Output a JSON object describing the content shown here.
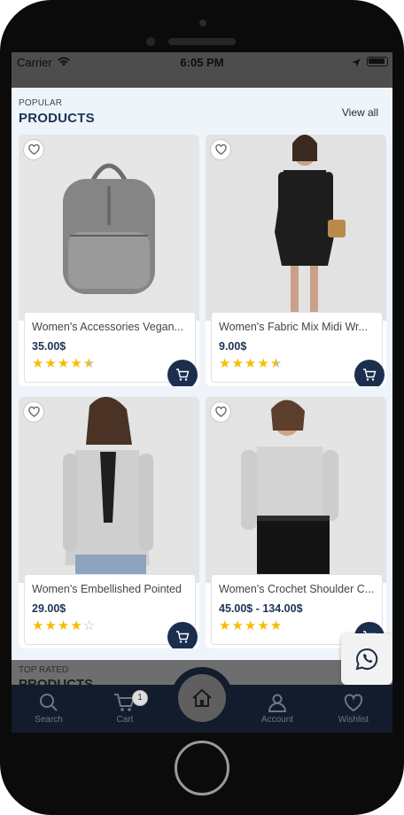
{
  "status_bar": {
    "carrier": "Carrier",
    "time": "6:05 PM",
    "wifi_icon": "wifi-icon",
    "location_icon": "location-arrow-icon",
    "battery_icon": "battery-icon"
  },
  "popular_section": {
    "overline": "POPULAR",
    "title": "PRODUCTS",
    "view_all_label": "View all"
  },
  "products": [
    {
      "name": "Women's Accessories Vegan...",
      "price": "35.00$",
      "rating": 4.5
    },
    {
      "name": "Women's Fabric Mix Midi Wr...",
      "price": "9.00$",
      "rating": 4.5
    },
    {
      "name": "Women's Embellished Pointed",
      "price": "29.00$",
      "rating": 4
    },
    {
      "name": "Women's Crochet Shoulder C...",
      "price": "45.00$ - 134.00$",
      "rating": 5
    }
  ],
  "top_rated_section": {
    "overline": "TOP RATED",
    "title": "PRODUCTS"
  },
  "bottom_nav": {
    "search": "Search",
    "cart": "Cart",
    "cart_count": "1",
    "account": "Account",
    "wishlist": "Wishlist"
  },
  "colors": {
    "brand_navy": "#1e3355",
    "star_yellow": "#f5bd00",
    "nav_background": "#131c2c",
    "content_background": "#eef4fa"
  }
}
